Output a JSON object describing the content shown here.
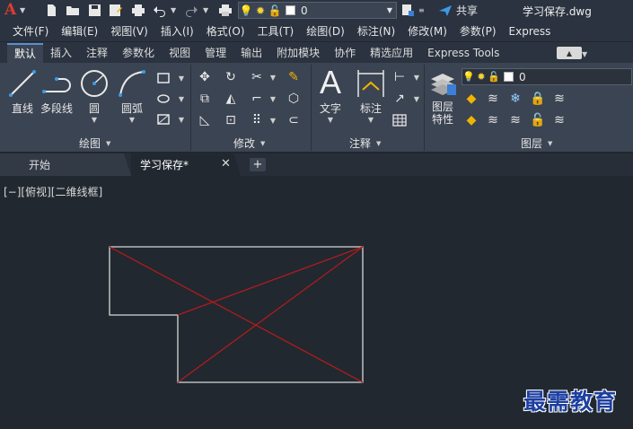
{
  "titlebar": {
    "logo": "A",
    "layer_value": "0",
    "share_label": "共享",
    "doc_title": "学习保存.dwg"
  },
  "menubar": {
    "items": [
      "文件(F)",
      "编辑(E)",
      "视图(V)",
      "插入(I)",
      "格式(O)",
      "工具(T)",
      "绘图(D)",
      "标注(N)",
      "修改(M)",
      "参数(P)",
      "Express"
    ]
  },
  "ribbon_tabs": {
    "items": [
      "默认",
      "插入",
      "注释",
      "参数化",
      "视图",
      "管理",
      "输出",
      "附加模块",
      "协作",
      "精选应用",
      "Express Tools"
    ],
    "active": "默认"
  },
  "ribbon": {
    "draw": {
      "line": "直线",
      "polyline": "多段线",
      "circle": "圆",
      "arc": "圆弧",
      "title": "绘图"
    },
    "modify": {
      "title": "修改"
    },
    "annotation": {
      "text": "文字",
      "dimension": "标注",
      "title": "注释"
    },
    "layers": {
      "props_line1": "图层",
      "props_line2": "特性",
      "layer_value": "0",
      "title": "图层"
    }
  },
  "filetabs": {
    "start": "开始",
    "doc": "学习保存*"
  },
  "viewport": {
    "controls": "[−][俯视][二维线框]",
    "watermark": "最需教育",
    "outline_color": "#d8d8d8",
    "diagonal_color": "#b31b1b"
  }
}
